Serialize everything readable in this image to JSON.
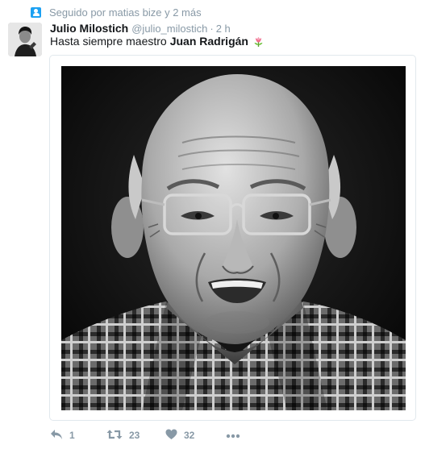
{
  "context": {
    "text": "Seguido por matias bize y 2 más",
    "icon": "follow-user-icon"
  },
  "tweet": {
    "fullname": "Julio Milostich",
    "username": "@julio_milostich",
    "separator": "·",
    "time": "2 h",
    "text_before": "Hasta siempre maestro",
    "text_bold": "Juan Radrigán",
    "emoji": "tulip-icon"
  },
  "media": {
    "alt": "black-and-white-portrait-photo"
  },
  "actions": {
    "reply_count": "1",
    "retweet_count": "23",
    "like_count": "32"
  },
  "colors": {
    "accent": "#1da1f2",
    "muted": "#8899a6",
    "text": "#14171a",
    "border": "#e1e8ed"
  }
}
